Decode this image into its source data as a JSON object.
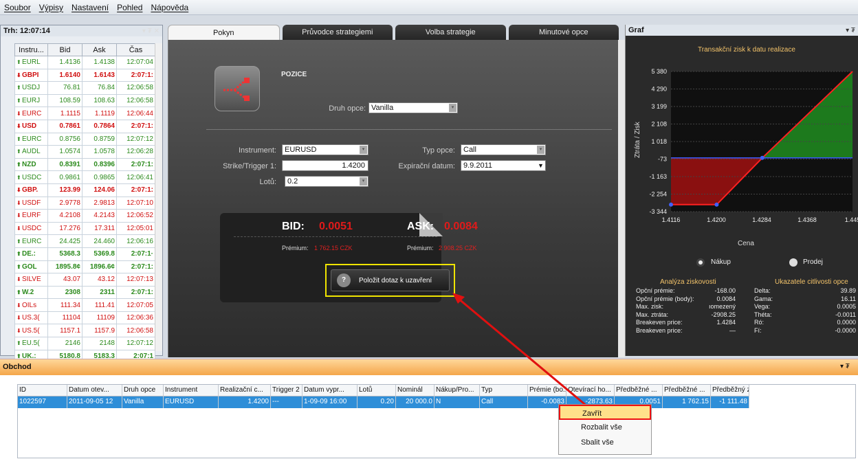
{
  "menu": [
    "Soubor",
    "Výpisy",
    "Nastavení",
    "Pohled",
    "Nápověda"
  ],
  "market": {
    "title": "Trh: 12:07:14",
    "controls": "▾ ₮ ✕",
    "headers": [
      "Instru...",
      "Bid",
      "Ask",
      "Čas"
    ],
    "rows": [
      {
        "dir": "up",
        "name": "EURL",
        "bid": "1.4136",
        "ask": "1.4138",
        "time": "12:07:04",
        "bold": false
      },
      {
        "dir": "down",
        "name": "GBPI",
        "bid": "1.6140",
        "ask": "1.6143",
        "time": "2:07:1:",
        "bold": true
      },
      {
        "dir": "up",
        "name": "USDJ",
        "bid": "76.81",
        "ask": "76.84",
        "time": "12:06:58",
        "bold": false
      },
      {
        "dir": "up",
        "name": "EURJ",
        "bid": "108.59",
        "ask": "108.63",
        "time": "12:06:58",
        "bold": false
      },
      {
        "dir": "down",
        "name": "EURC",
        "bid": "1.1115",
        "ask": "1.1119",
        "time": "12:06:44",
        "bold": false
      },
      {
        "dir": "down",
        "name": "USD",
        "bid": "0.7861",
        "ask": "0.7864",
        "time": "2:07:1:",
        "bold": true
      },
      {
        "dir": "up",
        "name": "EURC",
        "bid": "0.8756",
        "ask": "0.8759",
        "time": "12:07:12",
        "bold": false
      },
      {
        "dir": "up",
        "name": "AUDL",
        "bid": "1.0574",
        "ask": "1.0578",
        "time": "12:06:28",
        "bold": false
      },
      {
        "dir": "up",
        "name": "NZD",
        "bid": "0.8391",
        "ask": "0.8396",
        "time": "2:07:1:",
        "bold": true
      },
      {
        "dir": "up",
        "name": "USDC",
        "bid": "0.9861",
        "ask": "0.9865",
        "time": "12:06:41",
        "bold": false
      },
      {
        "dir": "down",
        "name": "GBP.",
        "bid": "123.99",
        "ask": "124.06",
        "time": "2:07:1:",
        "bold": true
      },
      {
        "dir": "down",
        "name": "USDF",
        "bid": "2.9778",
        "ask": "2.9813",
        "time": "12:07:10",
        "bold": false
      },
      {
        "dir": "down",
        "name": "EURF",
        "bid": "4.2108",
        "ask": "4.2143",
        "time": "12:06:52",
        "bold": false
      },
      {
        "dir": "down",
        "name": "USDC",
        "bid": "17.276",
        "ask": "17.311",
        "time": "12:05:01",
        "bold": false
      },
      {
        "dir": "up",
        "name": "EURC",
        "bid": "24.425",
        "ask": "24.460",
        "time": "12:06:16",
        "bold": false
      },
      {
        "dir": "up",
        "name": "DE.:",
        "bid": "5368.3",
        "ask": "5369.8",
        "time": "2:07:1·",
        "bold": true
      },
      {
        "dir": "up",
        "name": "GOL",
        "bid": "1895.8¢",
        "ask": "1896.6¢",
        "time": "2:07:1:",
        "bold": true
      },
      {
        "dir": "down",
        "name": "SILVE",
        "bid": "43.07",
        "ask": "43.12",
        "time": "12:07:13",
        "bold": false
      },
      {
        "dir": "up",
        "name": "W.2",
        "bid": "2308",
        "ask": "2311",
        "time": "2:07:1:",
        "bold": true
      },
      {
        "dir": "down",
        "name": "OILs",
        "bid": "111.34",
        "ask": "111.41",
        "time": "12:07:05",
        "bold": false
      },
      {
        "dir": "down",
        "name": "US.3(",
        "bid": "11104",
        "ask": "11109",
        "time": "12:06:36",
        "bold": false
      },
      {
        "dir": "down",
        "name": "US.5(",
        "bid": "1157.1",
        "ask": "1157.9",
        "time": "12:06:58",
        "bold": false
      },
      {
        "dir": "up",
        "name": "EU.5(",
        "bid": "2146",
        "ask": "2148",
        "time": "12:07:12",
        "bold": false
      },
      {
        "dir": "up",
        "name": "UK.:",
        "bid": "5180.8",
        "ask": "5183.3",
        "time": "2:07:1",
        "bold": true
      }
    ]
  },
  "tabs": [
    "Pokyn",
    "Průvodce strategiemi",
    "Volba strategie",
    "Minutové opce"
  ],
  "pokyn": {
    "section": "POZICE",
    "druh_label": "Druh opce:",
    "druh_value": "Vanilla",
    "instrument_label": "Instrument:",
    "instrument_value": "EURUSD",
    "strike_label": "Strike/Trigger 1:",
    "strike_value": "1.4200",
    "lotu_label": "Lotů:",
    "lotu_value": "0.2",
    "typ_label": "Typ opce:",
    "typ_value": "Call",
    "exp_label": "Expirační datum:",
    "exp_value": "9.9.2011",
    "bid_label": "BID:",
    "bid_value": "0.0051",
    "ask_label": "ASK:",
    "ask_value": "0.0084",
    "prem_label": "Prémium:",
    "prem_bid": "1 762.15 CZK",
    "prem_ask": "2 908.25 CZK",
    "button": "Položit dotaz k uzavření"
  },
  "graf": {
    "title": "Graf",
    "controls": "▾ ₮",
    "chart_title": "Transakční zisk k datu realizace",
    "nakup": "Nákup",
    "prodej": "Prodej",
    "analysis_title": "Analýza ziskovosti",
    "sens_title": "Ukazatele citlivosti opce",
    "analysis": [
      [
        "Opční prémie:",
        "-168.00"
      ],
      [
        "Opční prémie (body):",
        "0.0084"
      ],
      [
        "Max. zisk:",
        "ıomezený"
      ],
      [
        "Max. ztráta:",
        "-2908.25"
      ],
      [
        "Breakeven price:",
        "1.4284"
      ],
      [
        "Breakeven price:",
        "—"
      ]
    ],
    "sens": [
      [
        "Delta:",
        "39.89"
      ],
      [
        "Gama:",
        "16.11"
      ],
      [
        "Vega:",
        "0.0005"
      ],
      [
        "Théta:",
        "-0.0011"
      ],
      [
        "Ró:",
        "0.0000"
      ],
      [
        "Fí:",
        "-0.0000"
      ]
    ]
  },
  "chart_data": {
    "type": "line",
    "title": "Transakční zisk k datu realizace",
    "xlabel": "Cena",
    "ylabel": "Ztráta / Zisk",
    "x_ticks": [
      "1.4116",
      "1.4200",
      "1.4284",
      "1.4368",
      "1.445"
    ],
    "y_ticks": [
      "5 380",
      "4 290",
      "3 199",
      "2 108",
      "1 018",
      "-73",
      "-1 163",
      "-2 254",
      "-3 344"
    ],
    "series": [
      {
        "values": [
          [
            1.4116,
            -2908.25
          ],
          [
            1.42,
            -2908.25
          ],
          [
            1.4284,
            0
          ],
          [
            1.445,
            5380
          ]
        ]
      }
    ],
    "xlim": [
      1.4116,
      1.445
    ],
    "ylim": [
      -3344,
      5380
    ]
  },
  "obchod": {
    "title": "Obchod",
    "controls": "▾ ₮",
    "headers": [
      "ID",
      "Datum otev...",
      "Druh opce",
      "Instrument",
      "Realizační c...",
      "Trigger 2",
      "Datum vypr...",
      "Lotů",
      "Nominál",
      "Nákup/Pro...",
      "Typ",
      "Prémie (bo...",
      "Otevírací ho...",
      "Předběžné ...",
      "Předběžné ...",
      "Předběžný z..."
    ],
    "row": [
      "1022597",
      "2011-09-05 12",
      "Vanilla",
      "EURUSD",
      "1.4200",
      "---",
      "1-09-09 16:00",
      "0.20",
      "20 000.0",
      "N",
      "Call",
      "-0.0083",
      "-2873.63",
      "0.0051",
      "1 762.15",
      "-1 111.48"
    ]
  },
  "context_menu": [
    "Zavřít",
    "Rozbalit vše",
    "Sbalit vše"
  ],
  "colors": {
    "accent_orange": "#f4a64a",
    "highlight_yellow": "#f0e400",
    "selection_blue": "#2e8ed8",
    "up_green": "#2b8a1c",
    "down_red": "#d01010"
  }
}
